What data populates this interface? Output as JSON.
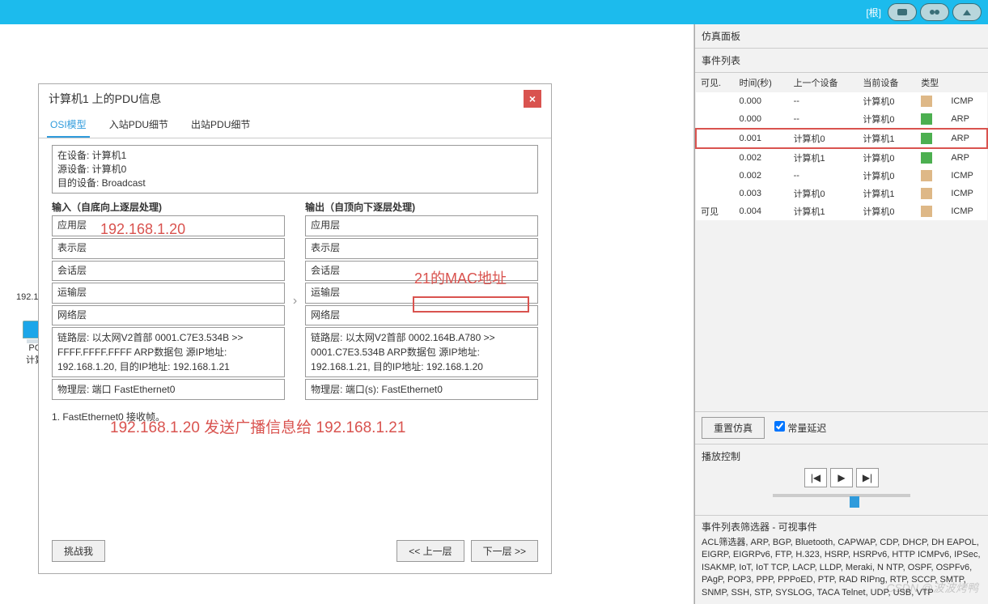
{
  "topbar": {
    "root_label": "[根]"
  },
  "canvas": {
    "pc_ip": "192.1",
    "pc_label1": "PC",
    "pc_label2": "计算"
  },
  "dialog": {
    "title": "计算机1 上的PDU信息",
    "close": "×",
    "tabs": {
      "osi": "OSI模型",
      "in": "入站PDU细节",
      "out": "出站PDU细节"
    },
    "device": {
      "at": "在设备: 计算机1",
      "src": "源设备: 计算机0",
      "dst": "目的设备: Broadcast"
    },
    "in_title": "输入（自底向上逐层处理)",
    "out_title": "输出（自顶向下逐层处理)",
    "layers": {
      "app": "应用层",
      "pres": "表示层",
      "sess": "会话层",
      "trans": "运输层",
      "net": "网络层"
    },
    "in_link": "链路层: 以太网V2首部 0001.C7E3.534B >> FFFF.FFFF.FFFF ARP数据包 源IP地址: 192.168.1.20, 目的IP地址: 192.168.1.21",
    "in_phys": "物理层: 端口 FastEthernet0",
    "out_link": "链路层: 以太网V2首部 0002.164B.A780 >> 0001.C7E3.534B ARP数据包 源IP地址: 192.168.1.21, 目的IP地址: 192.168.1.20",
    "out_phys": "物理层: 端口(s): FastEthernet0",
    "proc1": "1. FastEthernet0 接收帧。",
    "challenge": "挑战我",
    "prev": "<< 上一层",
    "next": "下一层 >>"
  },
  "annotations": {
    "ip20": "192.168.1.20",
    "mac21": "21的MAC地址",
    "broadcast": "192.168.1.20 发送广播信息给 192.168.1.21"
  },
  "sim": {
    "panel_title": "仿真面板",
    "event_list": "事件列表",
    "headers": {
      "visible": "可见.",
      "time": "时间(秒)",
      "prev": "上一个设备",
      "curr": "当前设备",
      "type": "类型"
    },
    "rows": [
      {
        "vis": "",
        "time": "0.000",
        "prev": "--",
        "curr": "计算机0",
        "color": "c-tan",
        "type": "ICMP"
      },
      {
        "vis": "",
        "time": "0.000",
        "prev": "--",
        "curr": "计算机0",
        "color": "c-green",
        "type": "ARP"
      },
      {
        "vis": "",
        "time": "0.001",
        "prev": "计算机0",
        "curr": "计算机1",
        "color": "c-green",
        "type": "ARP",
        "hl": true
      },
      {
        "vis": "",
        "time": "0.002",
        "prev": "计算机1",
        "curr": "计算机0",
        "color": "c-green",
        "type": "ARP"
      },
      {
        "vis": "",
        "time": "0.002",
        "prev": "--",
        "curr": "计算机0",
        "color": "c-tan",
        "type": "ICMP"
      },
      {
        "vis": "",
        "time": "0.003",
        "prev": "计算机0",
        "curr": "计算机1",
        "color": "c-tan",
        "type": "ICMP"
      },
      {
        "vis": "可见",
        "time": "0.004",
        "prev": "计算机1",
        "curr": "计算机0",
        "color": "c-tan",
        "type": "ICMP"
      }
    ],
    "reset": "重置仿真",
    "constant_delay": "常量延迟",
    "play_title": "播放控制",
    "filter_title": "事件列表筛选器 - 可视事件",
    "filter_text": "ACL筛选器, ARP, BGP, Bluetooth, CAPWAP, CDP, DHCP, DH EAPOL, EIGRP, EIGRPv6, FTP, H.323, HSRP, HSRPv6, HTTP ICMPv6, IPSec, ISAKMP, IoT, IoT TCP, LACP, LLDP, Meraki, N NTP, OSPF, OSPFv6, PAgP, POP3, PPP, PPPoED, PTP, RAD RIPng, RTP, SCCP, SMTP, SNMP, SSH, STP, SYSLOG, TACA Telnet, UDP, USB, VTP"
  },
  "watermark": "CSDN @波波烤鸭"
}
